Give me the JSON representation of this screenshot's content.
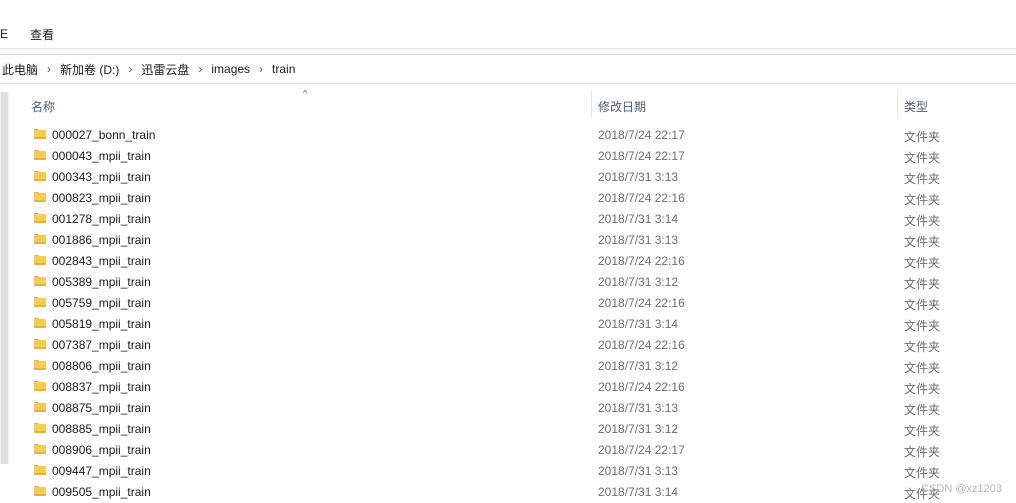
{
  "ribbon": {
    "cut_text": "E",
    "view_tab": "查看"
  },
  "breadcrumb": [
    "此电脑",
    "新加卷 (D:)",
    "迅雷云盘",
    "images",
    "train"
  ],
  "breadcrumb_separator": "›",
  "columns": {
    "name": "名称",
    "modified": "修改日期",
    "type": "类型"
  },
  "sort_indicator": "^",
  "files": [
    {
      "name": "000027_bonn_train",
      "date": "2018/7/24 22:17",
      "type": "文件夹"
    },
    {
      "name": "000043_mpii_train",
      "date": "2018/7/24 22:17",
      "type": "文件夹"
    },
    {
      "name": "000343_mpii_train",
      "date": "2018/7/31 3:13",
      "type": "文件夹"
    },
    {
      "name": "000823_mpii_train",
      "date": "2018/7/24 22:16",
      "type": "文件夹"
    },
    {
      "name": "001278_mpii_train",
      "date": "2018/7/31 3:14",
      "type": "文件夹"
    },
    {
      "name": "001886_mpii_train",
      "date": "2018/7/31 3:13",
      "type": "文件夹"
    },
    {
      "name": "002843_mpii_train",
      "date": "2018/7/24 22:16",
      "type": "文件夹"
    },
    {
      "name": "005389_mpii_train",
      "date": "2018/7/31 3:12",
      "type": "文件夹"
    },
    {
      "name": "005759_mpii_train",
      "date": "2018/7/24 22:16",
      "type": "文件夹"
    },
    {
      "name": "005819_mpii_train",
      "date": "2018/7/31 3:14",
      "type": "文件夹"
    },
    {
      "name": "007387_mpii_train",
      "date": "2018/7/24 22:16",
      "type": "文件夹"
    },
    {
      "name": "008806_mpii_train",
      "date": "2018/7/31 3:12",
      "type": "文件夹"
    },
    {
      "name": "008837_mpii_train",
      "date": "2018/7/24 22:16",
      "type": "文件夹"
    },
    {
      "name": "008875_mpii_train",
      "date": "2018/7/31 3:13",
      "type": "文件夹"
    },
    {
      "name": "008885_mpii_train",
      "date": "2018/7/31 3:12",
      "type": "文件夹"
    },
    {
      "name": "008906_mpii_train",
      "date": "2018/7/24 22:17",
      "type": "文件夹"
    },
    {
      "name": "009447_mpii_train",
      "date": "2018/7/31 3:13",
      "type": "文件夹"
    },
    {
      "name": "009505_mpii_train",
      "date": "2018/7/31 3:14",
      "type": "文件夹"
    }
  ],
  "watermark": "CSDN @xz1203",
  "icons": {
    "folder": "folder-icon",
    "breadcrumb_separator": "chevron-right-icon",
    "sort": "sort-up-icon"
  },
  "colors": {
    "folder": "#f6cb57",
    "header_text": "#4c607a",
    "secondary_text": "#6d6d6d"
  }
}
